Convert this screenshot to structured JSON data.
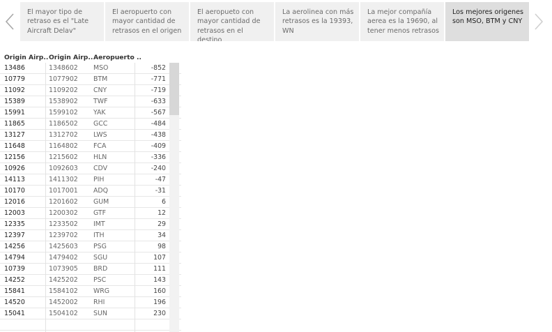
{
  "story": {
    "points": [
      "El mayor tipo de retraso es el \"Late Aircraft Delav\"",
      "El aeropuerto con mayor cantidad de retrasos en el origen",
      "El aeropueto con mayor cantidad de retrasos en el destino",
      "La aerolinea con más retrasos es la 19393, WN",
      "La mejor compañía aerea es la 19690, al tener menos retrasos",
      "Los mejores origenes son MSO, BTM y CNY"
    ],
    "active_index": 5,
    "prev_icon": "chevron-left-icon",
    "next_icon": "chevron-right-icon"
  },
  "table": {
    "headers": [
      "Origin Airp..",
      "Origin Airp..",
      "Aeropuerto .."
    ],
    "rows": [
      [
        "13486",
        "1348602",
        "MSO",
        "-852"
      ],
      [
        "10779",
        "1077902",
        "BTM",
        "-771"
      ],
      [
        "11092",
        "1109202",
        "CNY",
        "-719"
      ],
      [
        "15389",
        "1538902",
        "TWF",
        "-633"
      ],
      [
        "15991",
        "1599102",
        "YAK",
        "-567"
      ],
      [
        "11865",
        "1186502",
        "GCC",
        "-484"
      ],
      [
        "13127",
        "1312702",
        "LWS",
        "-438"
      ],
      [
        "11648",
        "1164802",
        "FCA",
        "-409"
      ],
      [
        "12156",
        "1215602",
        "HLN",
        "-336"
      ],
      [
        "10926",
        "1092603",
        "CDV",
        "-240"
      ],
      [
        "14113",
        "1411302",
        "PIH",
        "-47"
      ],
      [
        "10170",
        "1017001",
        "ADQ",
        "-31"
      ],
      [
        "12016",
        "1201602",
        "GUM",
        "6"
      ],
      [
        "12003",
        "1200302",
        "GTF",
        "12"
      ],
      [
        "12335",
        "1233502",
        "IMT",
        "29"
      ],
      [
        "12397",
        "1239702",
        "ITH",
        "34"
      ],
      [
        "14256",
        "1425603",
        "PSG",
        "98"
      ],
      [
        "14794",
        "1479402",
        "SGU",
        "107"
      ],
      [
        "10739",
        "1073905",
        "BRD",
        "111"
      ],
      [
        "14252",
        "1425202",
        "PSC",
        "143"
      ],
      [
        "15841",
        "1584102",
        "WRG",
        "160"
      ],
      [
        "14520",
        "1452002",
        "RHI",
        "196"
      ],
      [
        "15041",
        "1504102",
        "SUN",
        "230"
      ],
      [
        "",
        "",
        "",
        ""
      ]
    ]
  }
}
